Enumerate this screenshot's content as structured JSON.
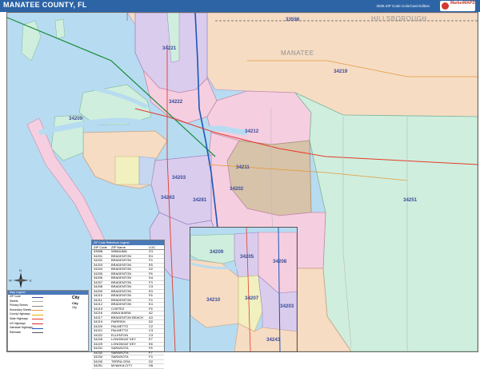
{
  "header": {
    "title": "MANATEE COUNTY, FL",
    "subtitle": "2026 ZIP Code ColorCast Edition",
    "logo_text": "MarketMAPS",
    "colors": {
      "bar": "#2d64a6"
    }
  },
  "map": {
    "county_labels": [
      "HILLSBOROUGH",
      "MANATEE"
    ],
    "zip_labels": [
      "33598",
      "34221",
      "34219",
      "34222",
      "34209",
      "34212",
      "34211",
      "34203",
      "34202",
      "34243",
      "34251",
      "34281"
    ],
    "colors": {
      "water": "#b7dcf2",
      "zip_pink": "#f5cfe0",
      "zip_peach": "#f7dcc4",
      "zip_green": "#cfeedd",
      "zip_purple": "#d9ccec",
      "zip_yellow": "#f3f0c0",
      "zip_tan": "#d7c3a9",
      "zip_blue": "#c6d8f1"
    }
  },
  "inset": {
    "zip_labels": [
      "34209",
      "34205",
      "34208",
      "34210",
      "34207",
      "34203",
      "34243"
    ]
  },
  "legend": {
    "title": "ZIP Code Reference Legend",
    "columns": [
      "ZIP Code",
      "ZIP Name",
      "LOC"
    ],
    "rows": [
      [
        "33598",
        "WIMAUMA",
        "G1"
      ],
      [
        "34201",
        "BRADENTON",
        "E4"
      ],
      [
        "34202",
        "BRADENTON",
        "F4"
      ],
      [
        "34203",
        "BRADENTON",
        "E5"
      ],
      [
        "34204",
        "BRADENTON",
        "D2"
      ],
      [
        "34205",
        "BRADENTON",
        "F6"
      ],
      [
        "34206",
        "BRADENTON",
        "D4"
      ],
      [
        "34207",
        "BRADENTON",
        "F3"
      ],
      [
        "34208",
        "BRADENTON",
        "C3"
      ],
      [
        "34209",
        "BRADENTON",
        "E3"
      ],
      [
        "34210",
        "BRADENTON",
        "F6"
      ],
      [
        "34211",
        "BRADENTON",
        "F4"
      ],
      [
        "34212",
        "BRADENTON",
        "E4"
      ],
      [
        "34215",
        "CORTEZ",
        "F5"
      ],
      [
        "34216",
        "ANNA MARIA",
        "A2"
      ],
      [
        "34217",
        "BRADENTON BEACH",
        "A3"
      ],
      [
        "34219",
        "PARRISH",
        "D2"
      ],
      [
        "34220",
        "PALMETTO",
        "C2"
      ],
      [
        "34221",
        "PALMETTO",
        "C3"
      ],
      [
        "34222",
        "ELLENTON",
        "C3"
      ],
      [
        "34228",
        "LONGBOAT KEY",
        "E7"
      ],
      [
        "34229",
        "LONGBOAT KEY",
        "E6"
      ],
      [
        "34231",
        "SARASOTA",
        "F6"
      ],
      [
        "34232",
        "SARASOTA",
        "F7"
      ],
      [
        "34234",
        "SARASOTA",
        "F3"
      ],
      [
        "34240",
        "TERRA CEIA",
        "D2"
      ],
      [
        "34251",
        "MYAKKA CITY",
        "H5"
      ]
    ]
  },
  "key": {
    "title": "Map Legend",
    "items": [
      {
        "label": "ZIP Code",
        "color": "#3c4d9a"
      },
      {
        "label": "Streets",
        "color": "#b0b0b0"
      },
      {
        "label": "Primary Streets",
        "color": "#888888"
      },
      {
        "label": "Secondary Streets",
        "color": "#e29a3b"
      },
      {
        "label": "County Highways",
        "color": "#e0b400"
      },
      {
        "label": "State Highways",
        "color": "#e53b2a"
      },
      {
        "label": "US Highways",
        "color": "#d52a2a"
      },
      {
        "label": "Interstate Highways",
        "color": "#1b57b7"
      },
      {
        "label": "Railroads",
        "color": "#555555"
      }
    ],
    "city_samples": [
      "City",
      "City",
      "City"
    ]
  },
  "compass": {
    "letters": [
      "N",
      "S",
      "E",
      "W"
    ]
  }
}
